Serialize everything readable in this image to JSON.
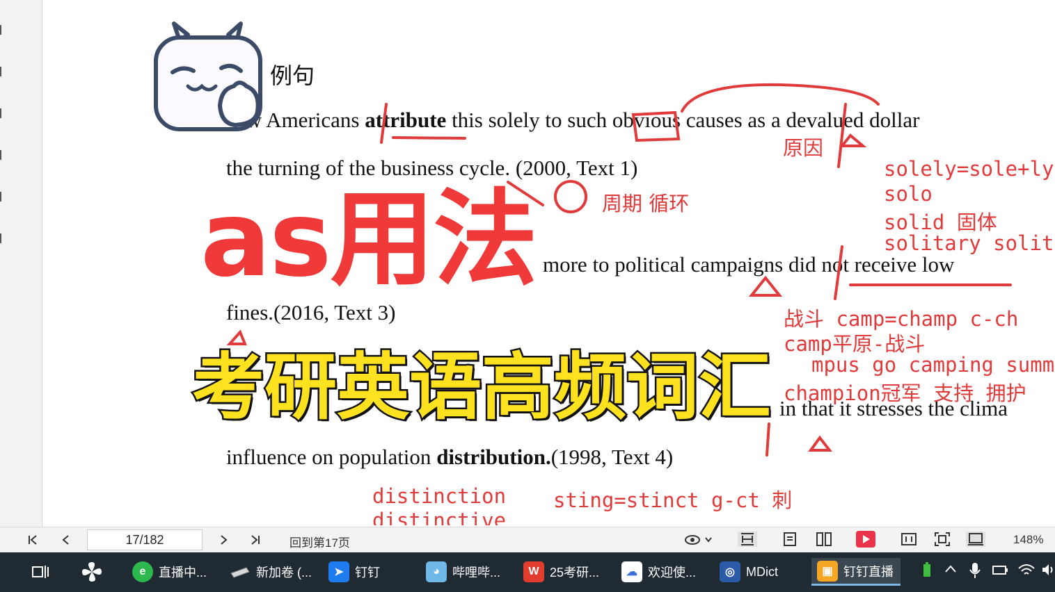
{
  "document": {
    "heading": "例句",
    "lines": [
      {
        "pre": "ew Americans ",
        "bold": "attribute",
        "post": " this solely to such obvious causes as a devalued dollar"
      },
      {
        "pre": "the turning of the business cycle. (2000, Text 1)",
        "bold": "",
        "post": ""
      },
      {
        "pre": "more to political campaigns did not receive low",
        "bold": "",
        "post": ""
      },
      {
        "pre": "fines.(2016, Text 3)",
        "bold": "",
        "post": ""
      },
      {
        "pre": "in that it stresses the clima",
        "bold": "",
        "post": ""
      },
      {
        "pre": "influence on population ",
        "bold": "distribution.",
        "post": "(1998, Text 4)"
      }
    ]
  },
  "annotations": {
    "yuanyin": "原因",
    "zhouqi": "周期 循环",
    "solely": "solely=sole+ly",
    "solo": "solo",
    "solid": "solid 固体",
    "solitary": "solitary solit",
    "zhandou": "战斗 camp=champ c-ch",
    "camp_plain": "camp平原-战斗",
    "campus": "mpus go camping summ",
    "champion": "champion冠军 支持 拥护",
    "distinction": "distinction",
    "sting": "sting=stinct g-ct 刺",
    "distinctive": "distinctive"
  },
  "overlay": {
    "title_red": "as用法",
    "title_yellow": "考研英语高频词汇"
  },
  "pdf_toolbar": {
    "page_value": "17/182",
    "goto_label": "回到第17页",
    "zoom": "148%"
  },
  "taskbar": {
    "items": [
      {
        "label": "直播中...",
        "color": "#2db84d",
        "icon": "e"
      },
      {
        "label": "新加卷 (...",
        "color": "#7a7a7a",
        "icon": ""
      },
      {
        "label": "钉钉",
        "color": "#1e7bf0",
        "icon": ""
      },
      {
        "label": "哔哩哔...",
        "color": "#6fb8e8",
        "icon": ""
      },
      {
        "label": "25考研...",
        "color": "#e23c2e",
        "icon": "W"
      },
      {
        "label": "欢迎使...",
        "color": "#3b6fd8",
        "icon": ""
      },
      {
        "label": "MDict",
        "color": "#2b5aa8",
        "icon": ""
      },
      {
        "label": "钉钉直播",
        "color": "#f5a623",
        "icon": ""
      }
    ]
  },
  "colors": {
    "annotation_red": "#e03a3a",
    "title_red": "#f03a3a",
    "title_yellow": "#ffe21f",
    "taskbar_bg": "#1f2a33"
  }
}
